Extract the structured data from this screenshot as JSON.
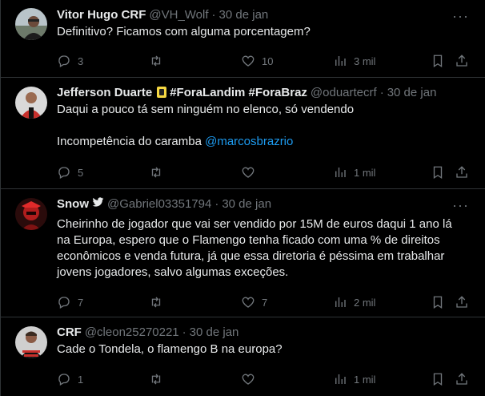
{
  "tweets": [
    {
      "name": "Vitor Hugo CRF",
      "handle": "@VH_Wolf",
      "date": "30 de jan",
      "text": [
        "Definitivo? Ficamos com alguma porcentagem?"
      ],
      "replies": "3",
      "retweets": "",
      "likes": "10",
      "views": "3 mil"
    },
    {
      "name": "Jefferson Duarte",
      "tags": "#ForaLandim #ForaBraz",
      "handle": "@oduartecrf",
      "date": "30 de jan",
      "text1": "Daqui a pouco tá sem ninguém no elenco, só vendendo",
      "text2": "Incompetência do caramba",
      "mention": "@marcosbrazrio",
      "replies": "5",
      "retweets": "",
      "likes": "",
      "views": "1 mil"
    },
    {
      "name": "Snow",
      "handle": "@Gabriel03351794",
      "date": "30 de jan",
      "text": [
        "Cheirinho de jogador que vai ser vendido por 15M de euros daqui 1 ano lá",
        "na Europa, espero que o Flamengo tenha ficado com uma % de direitos",
        "econômicos e venda futura, já que essa diretoria é péssima em trabalhar",
        "jovens jogadores, salvo algumas exceções."
      ],
      "replies": "7",
      "retweets": "",
      "likes": "7",
      "views": "2 mil"
    },
    {
      "name": "CRF",
      "handle": "@cleon25270221",
      "date": "30 de jan",
      "text": [
        "Cade o Tondela, o flamengo B na europa?"
      ],
      "replies": "1",
      "retweets": "",
      "likes": "",
      "views": "1 mil"
    }
  ],
  "more_glyph": "···",
  "dot": "·"
}
